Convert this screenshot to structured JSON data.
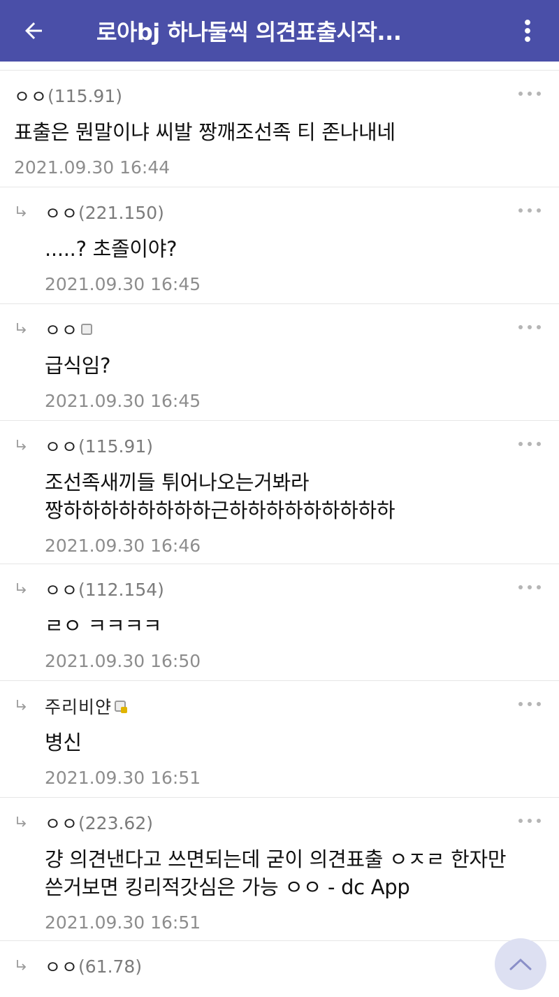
{
  "header": {
    "title": "로아bj 하나둘씩 의견표출시작...",
    "bar_color": "#4a4fa8"
  },
  "icons": {
    "back": "arrow-left-icon",
    "more": "vertical-dots-icon",
    "reply": "reply-arrow-icon",
    "comment_menu": "horizontal-dots-icon",
    "scroll_top": "chevron-up-icon"
  },
  "comments": [
    {
      "author": "ㅇㅇ",
      "ip": "(115.91)",
      "text": "표출은 뭔말이냐 씨발 짱깨조선족 티 존나내네",
      "date": "2021.09.30 16:44"
    },
    {
      "author": "ㅇㅇ",
      "ip": "(221.150)",
      "text": ".....? 초졸이야?",
      "date": "2021.09.30 16:45"
    },
    {
      "author": "ㅇㅇ",
      "ip": "",
      "text": "급식임?",
      "date": "2021.09.30 16:45"
    },
    {
      "author": "ㅇㅇ",
      "ip": "(115.91)",
      "text_line1": "조선족새끼들 튀어나오는거봐라",
      "text_line2": "짱하하하하하하하하근하하하하하하하하하",
      "date": "2021.09.30 16:46"
    },
    {
      "author": "ㅇㅇ",
      "ip": "(112.154)",
      "text": "ㄹㅇ ㅋㅋㅋㅋ",
      "date": "2021.09.30 16:50"
    },
    {
      "author": "주리비얀",
      "ip": "",
      "text": "병신",
      "date": "2021.09.30 16:51"
    },
    {
      "author": "ㅇㅇ",
      "ip": "(223.62)",
      "text_line1": "걍 의견낸다고 쓰면되는데 굳이 의견표출 ㅇㅈㄹ 한자만",
      "text_line2": "쓴거보면 킹리적갓심은 가능 ㅇㅇ - dc App",
      "date": "2021.09.30 16:51"
    },
    {
      "author": "ㅇㅇ",
      "ip": "(61.78)"
    }
  ]
}
